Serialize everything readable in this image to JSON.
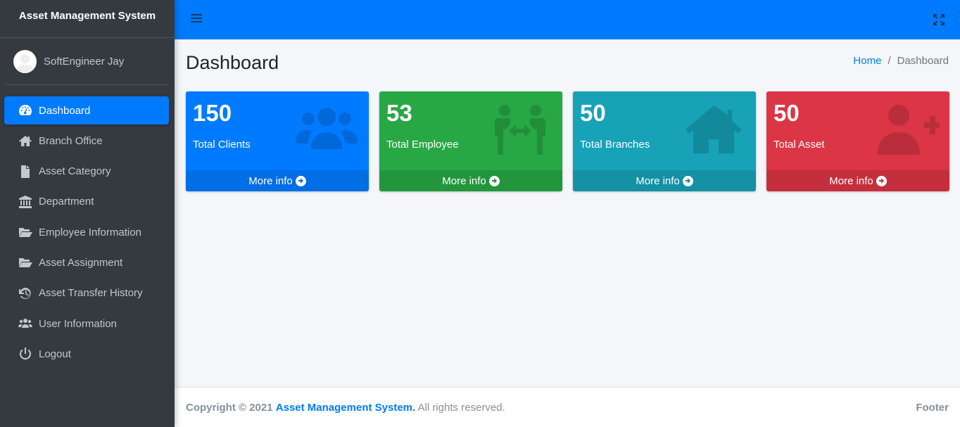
{
  "brand": {
    "title": "Asset Management System"
  },
  "user": {
    "name": "SoftEngineer Jay"
  },
  "sidebar": {
    "items": [
      {
        "label": "Dashboard",
        "icon": "tachometer-icon",
        "active": true
      },
      {
        "label": "Branch Office",
        "icon": "home-icon"
      },
      {
        "label": "Asset Category",
        "icon": "file-icon"
      },
      {
        "label": "Department",
        "icon": "university-icon"
      },
      {
        "label": "Employee Information",
        "icon": "folder-open-icon"
      },
      {
        "label": "Asset Assignment",
        "icon": "folder-open-icon"
      },
      {
        "label": "Asset Transfer History",
        "icon": "history-icon"
      },
      {
        "label": "User Information",
        "icon": "users-icon"
      },
      {
        "label": "Logout",
        "icon": "power-off-icon"
      }
    ]
  },
  "page": {
    "title": "Dashboard"
  },
  "breadcrumb": {
    "home": "Home",
    "separator": "/",
    "current": "Dashboard"
  },
  "cards": [
    {
      "value": "150",
      "label": "Total Clients",
      "footer": "More info",
      "color": "#007bff",
      "icon": "users-icon"
    },
    {
      "value": "53",
      "label": "Total Employee",
      "footer": "More info",
      "color": "#28a745",
      "icon": "people-arrows-icon"
    },
    {
      "value": "50",
      "label": "Total Branches",
      "footer": "More info",
      "color": "#17a2b8",
      "icon": "home-icon"
    },
    {
      "value": "50",
      "label": "Total Asset",
      "footer": "More info",
      "color": "#dc3545",
      "icon": "user-plus-icon"
    }
  ],
  "footer": {
    "copyright": "Copyright © 2021",
    "link": "Asset Management System.",
    "rights": "All rights reserved.",
    "right_text": "Footer"
  },
  "colors": {
    "primary": "#007bff",
    "sidebar_bg": "#343a40",
    "content_bg": "#f4f6f9"
  }
}
